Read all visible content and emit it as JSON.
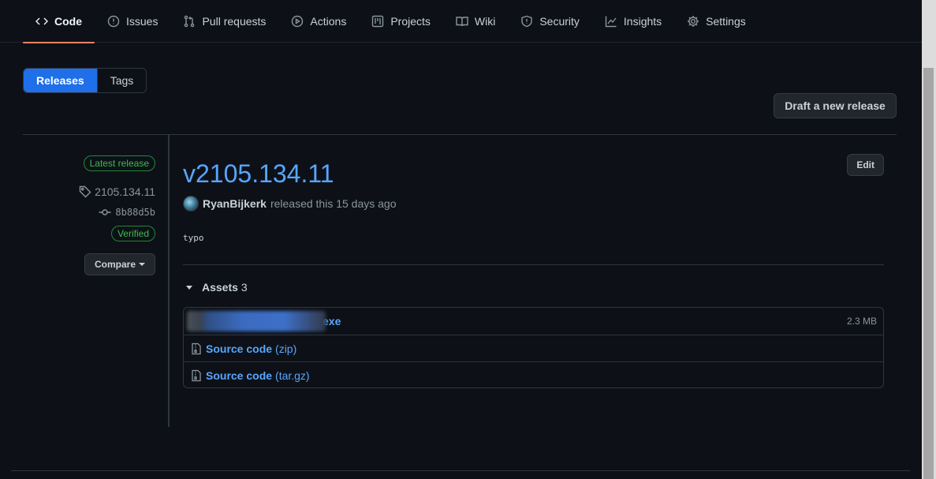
{
  "nav": {
    "tabs": [
      {
        "label": "Code",
        "icon": "code-icon",
        "active": true
      },
      {
        "label": "Issues",
        "icon": "issue-icon"
      },
      {
        "label": "Pull requests",
        "icon": "pull-request-icon"
      },
      {
        "label": "Actions",
        "icon": "play-icon"
      },
      {
        "label": "Projects",
        "icon": "project-icon"
      },
      {
        "label": "Wiki",
        "icon": "book-icon"
      },
      {
        "label": "Security",
        "icon": "shield-icon"
      },
      {
        "label": "Insights",
        "icon": "graph-icon"
      },
      {
        "label": "Settings",
        "icon": "gear-icon"
      }
    ]
  },
  "subnav": {
    "releases_label": "Releases",
    "tags_label": "Tags"
  },
  "draft_button": "Draft a new release",
  "meta": {
    "latest_badge": "Latest release",
    "tag": "2105.134.11",
    "commit": "8b88d5b",
    "verified": "Verified",
    "compare": "Compare"
  },
  "release": {
    "title": "v2105.134.11",
    "edit": "Edit",
    "author": "RyanBijkerk",
    "released_text": "released this 15 days ago",
    "notes": "typo"
  },
  "assets": {
    "title": "Assets",
    "count": "3",
    "items": [
      {
        "name_suffix": "exe",
        "size": "2.3 MB"
      },
      {
        "name": "Source code",
        "format": "(zip)"
      },
      {
        "name": "Source code",
        "format": "(tar.gz)"
      }
    ]
  },
  "colors": {
    "background": "#0d1117",
    "accent_blue": "#58a6ff",
    "selected_blue": "#1f6feb",
    "active_underline": "#f78166",
    "success_green": "#3fb950"
  }
}
